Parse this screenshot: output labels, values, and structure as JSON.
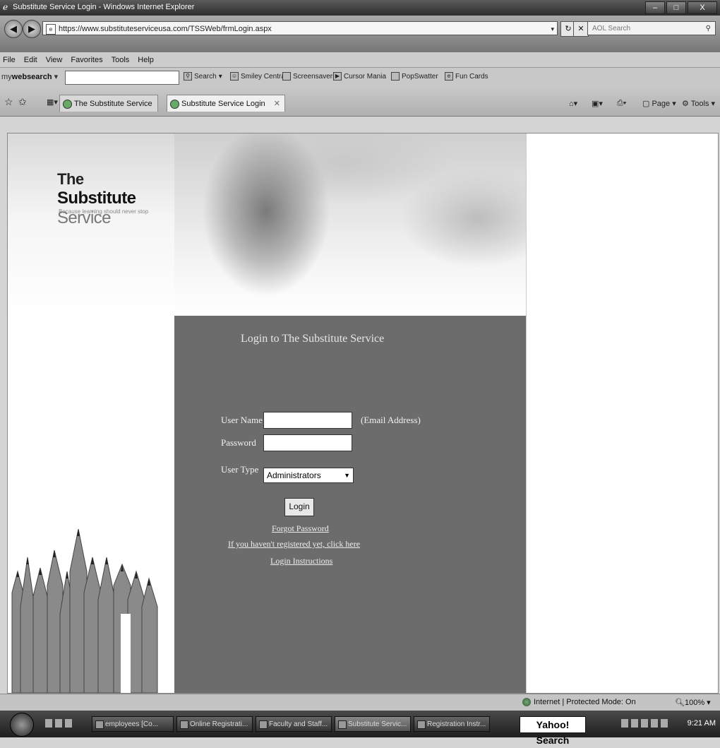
{
  "window": {
    "title": "Substitute Service Login - Windows Internet Explorer"
  },
  "address_bar": {
    "url": "https://www.substituteserviceusa.com/TSSWeb/frmLogin.aspx",
    "search_placeholder": "AOL Search"
  },
  "menu": [
    "File",
    "Edit",
    "View",
    "Favorites",
    "Tools",
    "Help"
  ],
  "toolbar": {
    "brand_prefix": "my",
    "brand_main": "websearch",
    "search_button": "Search",
    "items": [
      "Smiley Central",
      "Screensavers",
      "Cursor Mania",
      "PopSwatter",
      "Fun Cards"
    ]
  },
  "tabs": [
    {
      "label": "The Substitute Service",
      "active": false
    },
    {
      "label": "Substitute Service Login",
      "active": true
    }
  ],
  "command_bar": {
    "page": "Page",
    "tools": "Tools"
  },
  "site": {
    "logo_the": "The",
    "logo_substitute": "Substitute",
    "logo_service": "Service",
    "tagline": "Because learning should never stop"
  },
  "login": {
    "heading": "Login to The Substitute Service",
    "username_label": "User Name",
    "username_hint": "(Email Address)",
    "password_label": "Password",
    "usertype_label": "User Type",
    "usertype_value": "Administrators",
    "login_button": "Login",
    "links": [
      "Forgot Password",
      "If you haven't registered yet, click here",
      "Login Instructions"
    ]
  },
  "status": {
    "zone": "Internet | Protected Mode: On",
    "zoom": "100%"
  },
  "taskbar": {
    "items": [
      "employees [Co...",
      "Online Registrati...",
      "Faculty and Staff...",
      "Substitute Servic...",
      "Registration Instr..."
    ],
    "yahoo_search": "Yahoo! Search",
    "clock": "9:21 AM"
  }
}
